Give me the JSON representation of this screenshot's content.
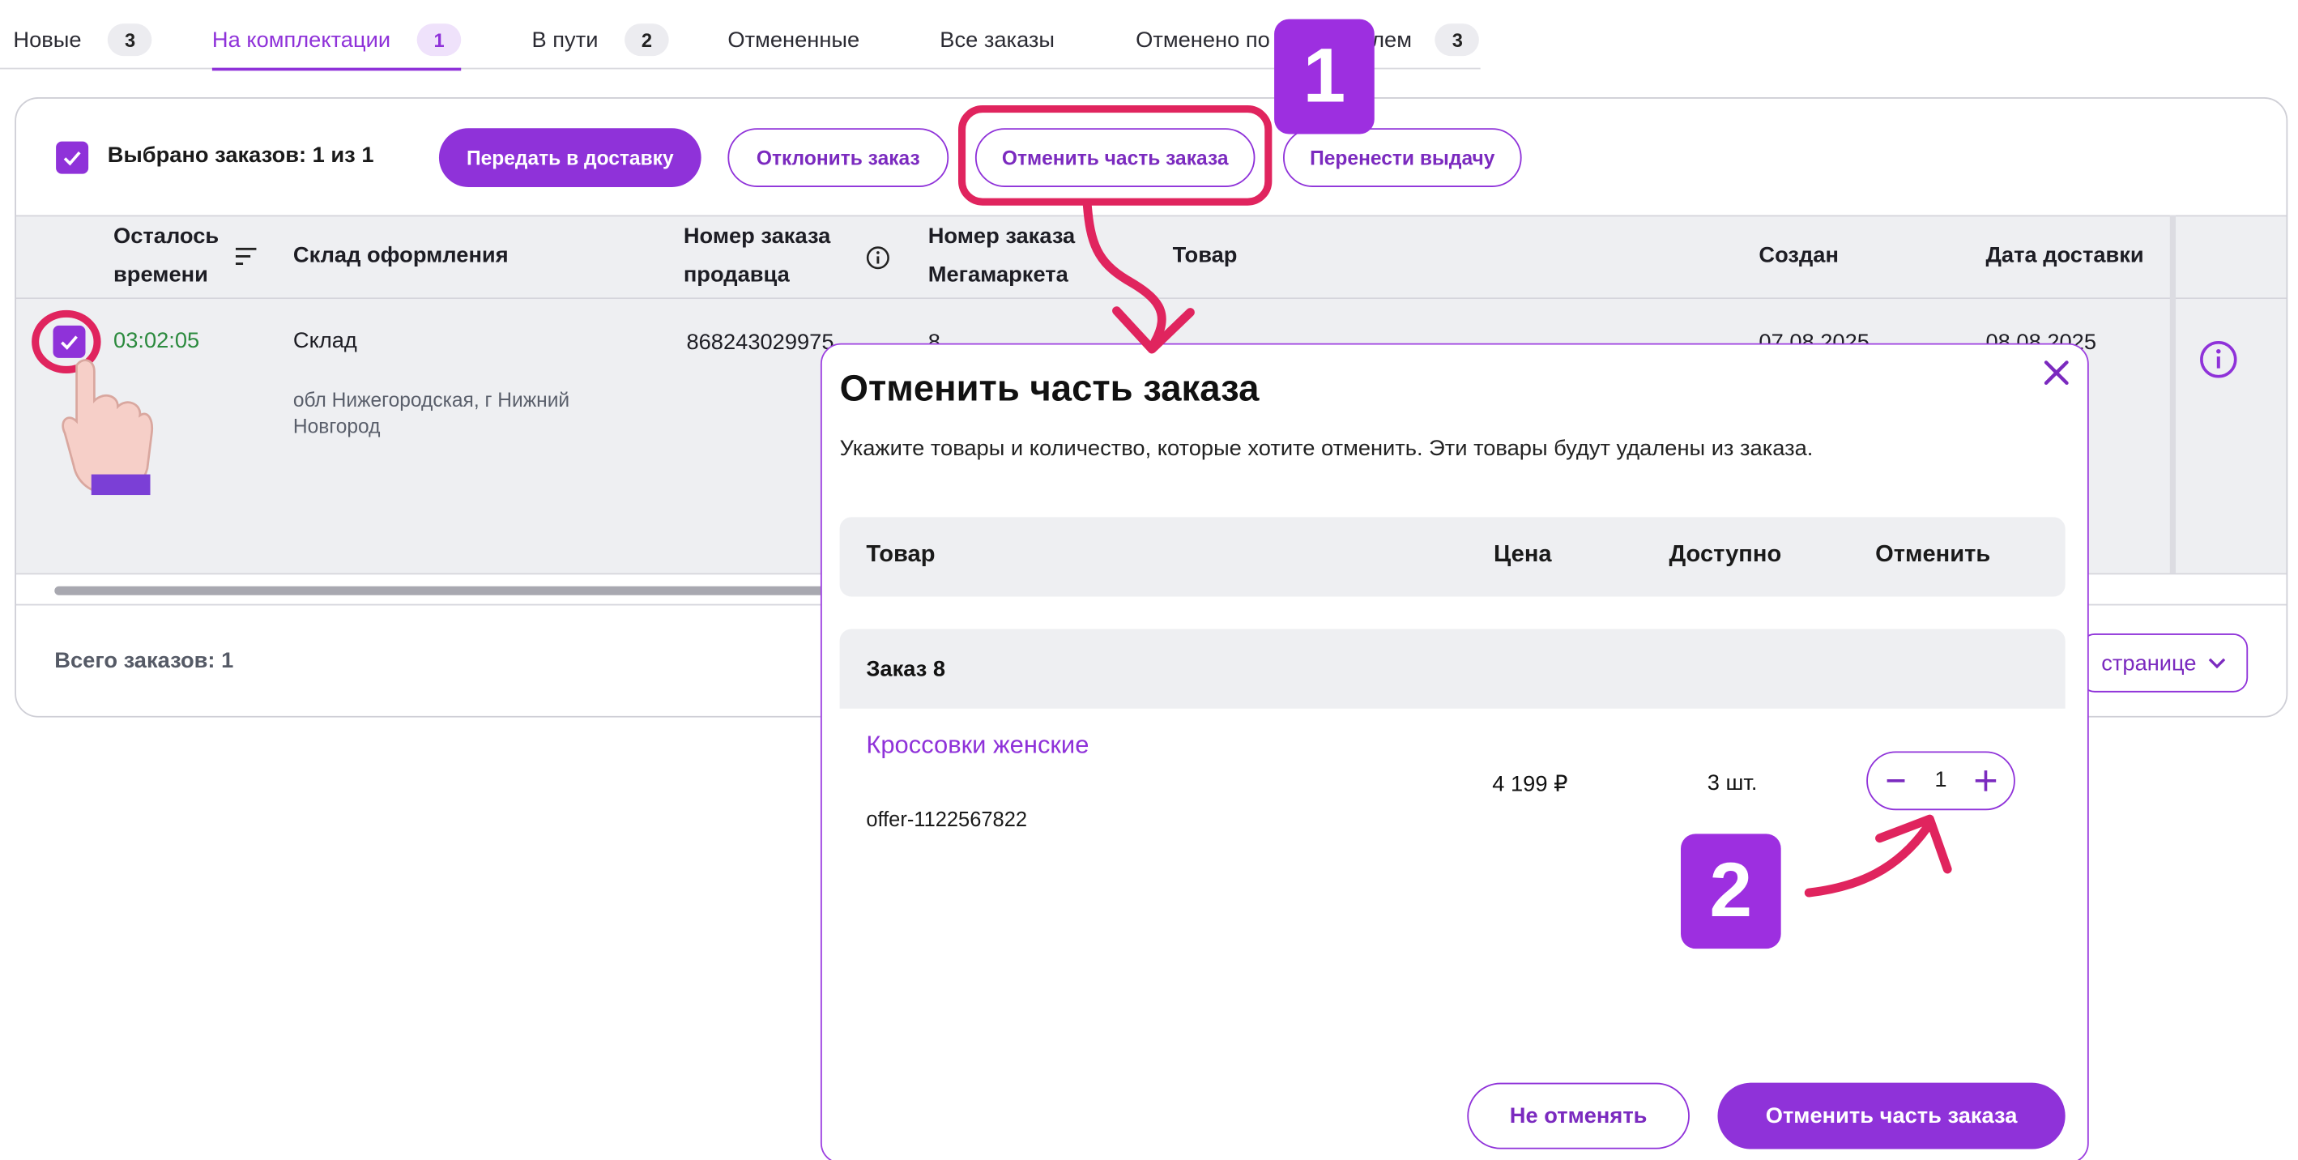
{
  "tabs": [
    {
      "label": "Новые",
      "count": "3"
    },
    {
      "label": "На комплектации",
      "count": "1"
    },
    {
      "label": "В пути",
      "count": "2"
    },
    {
      "label": "Отмененные",
      "count": ""
    },
    {
      "label": "Все заказы",
      "count": ""
    },
    {
      "label": "Отменено по",
      "label_tail": "лем",
      "count": "3"
    }
  ],
  "toolbar": {
    "selected_text": "Выбрано заказов: 1 из 1",
    "deliver_label": "Передать в доставку",
    "reject_label": "Отклонить заказ",
    "cancel_part_label": "Отменить часть заказа",
    "reschedule_label": "Перенести выдачу"
  },
  "table": {
    "headers": {
      "time_left": [
        "Осталось",
        "времени"
      ],
      "warehouse": "Склад оформления",
      "seller_order": [
        "Номер заказа",
        "продавца"
      ],
      "mm_order": [
        "Номер заказа",
        "Мегамаркета"
      ],
      "product": "Товар",
      "created": "Создан",
      "delivery_date": "Дата доставки"
    },
    "row": {
      "time_left": "03:02:05",
      "warehouse_name": "Склад",
      "warehouse_address": [
        "обл Нижегородская, г Нижний",
        "Новгород"
      ],
      "seller_order": "868243029975",
      "mm_order": "8",
      "created": "07.08.2025",
      "delivery_date": "08.08.2025"
    }
  },
  "footer": {
    "total": "Всего заказов: 1",
    "per_page": "странице"
  },
  "modal": {
    "title": "Отменить часть заказа",
    "description": "Укажите товары и количество, которые хотите отменить. Эти товары будут удалены из заказа.",
    "headers": {
      "product": "Товар",
      "price": "Цена",
      "available": "Доступно",
      "cancel": "Отменить"
    },
    "group": "Заказ 8",
    "item": {
      "name": "Кроссовки женские",
      "sku": "offer-1122567822",
      "price": "4 199 ₽",
      "available": "3 шт.",
      "quantity": "1"
    },
    "keep_label": "Не отменять",
    "confirm_label": "Отменить часть заказа"
  },
  "annotations": {
    "step1": "1",
    "step2": "2"
  },
  "colors": {
    "accent": "#8f32d9",
    "timer": "#2b8a3e",
    "highlight": "#e0245e",
    "badge": "#9d2fe0"
  }
}
